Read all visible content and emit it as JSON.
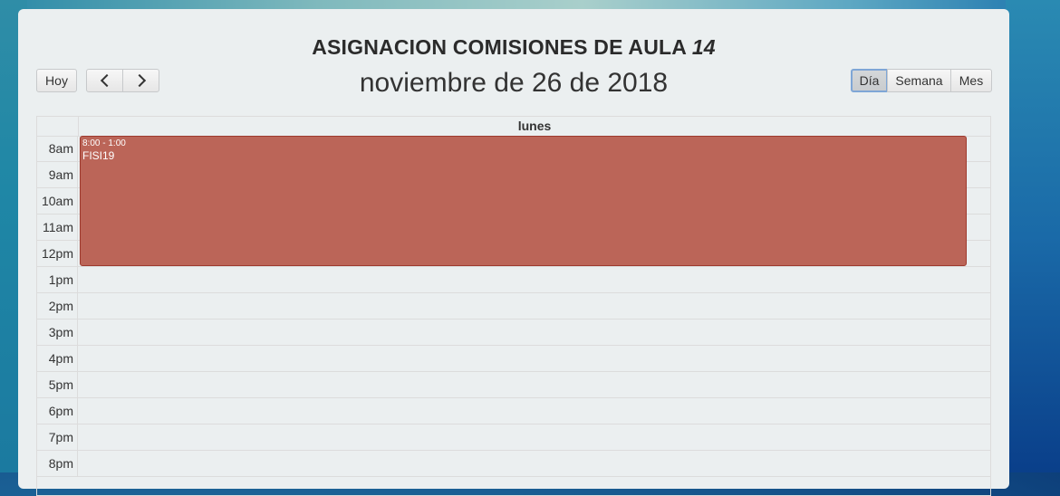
{
  "calendar": {
    "title_main": "ASIGNACION COMISIONES DE AULA ",
    "title_room": "14",
    "date_heading": "noviembre de 26 de 2018",
    "day_header": "lunes"
  },
  "toolbar": {
    "today_label": "Hoy",
    "view_day_label": "Día",
    "view_week_label": "Semana",
    "view_month_label": "Mes",
    "active_view": "Día"
  },
  "time_slots": [
    "8am",
    "9am",
    "10am",
    "11am",
    "12pm",
    "1pm",
    "2pm",
    "3pm",
    "4pm",
    "5pm",
    "6pm",
    "7pm",
    "8pm"
  ],
  "events": [
    {
      "time": "8:00 - 1:00",
      "title": "FISI19",
      "color": "#bb6558"
    }
  ],
  "colors": {
    "panel_bg": "#ebeff0",
    "event_bg": "#bb6558",
    "active_button_border": "#7fa6d6"
  }
}
